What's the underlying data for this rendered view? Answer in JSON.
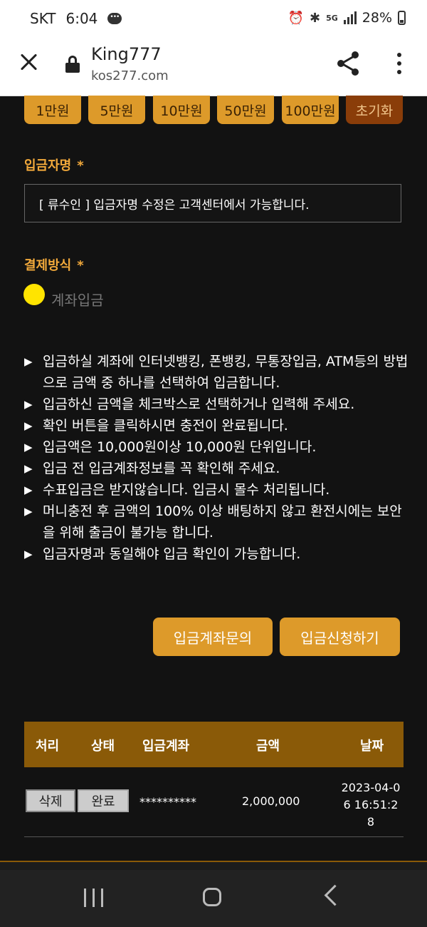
{
  "status_bar": {
    "carrier": "SKT",
    "time": "6:04",
    "network": "5G",
    "battery": "28%"
  },
  "browser": {
    "title": "King777",
    "url": "kos277.com"
  },
  "amount_buttons": [
    "1만원",
    "5만원",
    "10만원",
    "50만원",
    "100만원",
    "초기화"
  ],
  "depositor": {
    "label": "입금자명",
    "required_mark": "*",
    "value": "[ 류수인 ] 입금자명 수정은 고객센터에서 가능합니다."
  },
  "payment": {
    "label": "결제방식",
    "required_mark": "*",
    "option": "계좌입금"
  },
  "notices": [
    "입금하실 계좌에 인터넷뱅킹, 폰뱅킹, 무통장입금, ATM등의 방법으로 금액 중 하나를 선택하여 입금합니다.",
    "입금하신 금액을 체크박스로 선택하거나 입력해 주세요.",
    "확인 버튼을 클릭하시면 충전이 완료됩니다.",
    "입금액은 10,000원이상 10,000원 단위입니다.",
    "입금 전 입금계좌정보를 꼭 확인해 주세요.",
    "수표입금은 받지않습니다. 입금시 몰수 처리됩니다.",
    "머니충전 후 금액의 100% 이상 배팅하지 않고 환전시에는 보안을 위해 출금이 불가능 합니다.",
    "입금자명과 동일해야 입금 확인이 가능합니다."
  ],
  "actions": {
    "inquiry": "입금계좌문의",
    "request": "입금신청하기"
  },
  "table": {
    "headers": [
      "처리",
      "상태",
      "입금계좌",
      "금액",
      "날짜"
    ],
    "rows": [
      {
        "delete_label": "삭제",
        "status": "완료",
        "account": "**********",
        "amount": "2,000,000",
        "date": "2023-04-06 16:51:28"
      }
    ]
  }
}
